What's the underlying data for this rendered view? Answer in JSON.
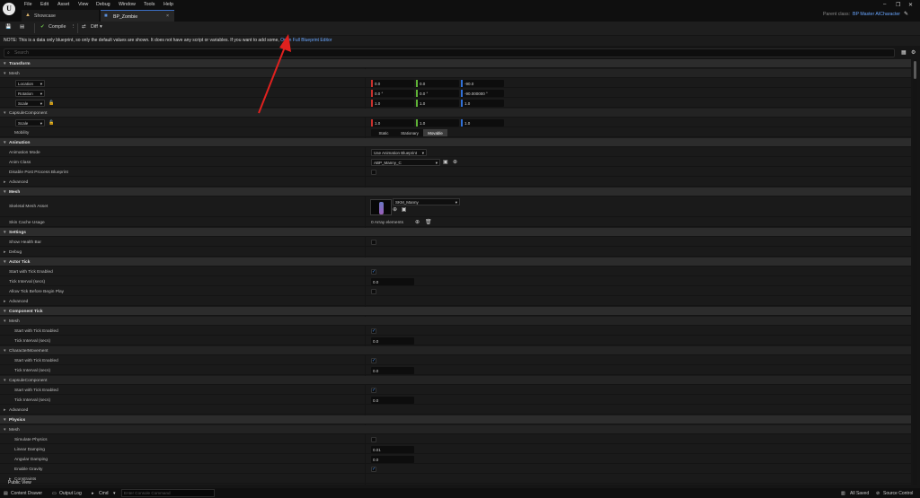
{
  "menu": [
    "File",
    "Edit",
    "Asset",
    "View",
    "Debug",
    "Window",
    "Tools",
    "Help"
  ],
  "tabs": [
    {
      "label": "Showcase"
    },
    {
      "label": "BP_Zombie"
    }
  ],
  "parent_class_label": "Parent class:",
  "parent_class_value": "BP Master AICharacter",
  "toolbar": {
    "compile": "Compile",
    "diff": "Diff"
  },
  "notice": {
    "text": "NOTE: This is a data only blueprint, so only the default values are shown.  It does not have any script or variables.  If you want to add some, ",
    "link": "Open Full Blueprint Editor"
  },
  "search": {
    "placeholder": "Search"
  },
  "transform": {
    "category": "Transform",
    "mesh_header": "Mesh",
    "location_label": "Location",
    "rotation_label": "Rotation",
    "scale_label": "Scale",
    "location": [
      "0.0",
      "0.0",
      "-90.0"
    ],
    "rotation": [
      "0.0 °",
      "0.0 °",
      "-90.000000 °"
    ],
    "scale": [
      "1.0",
      "1.0",
      "1.0"
    ],
    "capsule_header": "CapsuleComponent",
    "capsule_scale": [
      "1.0",
      "1.0",
      "1.0"
    ],
    "mobility_label": "Mobility",
    "mobility_options": [
      "Static",
      "Stationary",
      "Movable"
    ],
    "mobility_selected": "Movable"
  },
  "animation": {
    "category": "Animation",
    "mode_label": "Animation Mode",
    "mode_value": "Use Animation Blueprint",
    "class_label": "Anim Class",
    "class_value": "ABP_Manny_C",
    "dpp_label": "Disable Post Process Blueprint",
    "advanced": "Advanced"
  },
  "mesh": {
    "category": "Mesh",
    "asset_label": "Skeletal Mesh Asset",
    "asset_value": "SKM_Manny",
    "skin_label": "Skin Cache Usage",
    "skin_value": "0 Array elements"
  },
  "settings": {
    "category": "Settings",
    "health_label": "Show Health Bar",
    "debug": "Debug"
  },
  "actor_tick": {
    "category": "Actor Tick",
    "start_label": "Start with Tick Enabled",
    "interval_label": "Tick Interval (secs)",
    "interval_value": "0.0",
    "allow_label": "Allow Tick Before Begin Play",
    "advanced": "Advanced"
  },
  "component_tick": {
    "category": "Component Tick",
    "groups": [
      {
        "name": "Mesh",
        "start": "Start with Tick Enabled",
        "interval": "Tick Interval (secs)",
        "value": "0.0"
      },
      {
        "name": "CharacterMovement",
        "start": "Start with Tick Enabled",
        "interval": "Tick Interval (secs)",
        "value": "0.0"
      },
      {
        "name": "CapsuleComponent",
        "start": "Start with Tick Enabled",
        "interval": "Tick Interval (secs)",
        "value": "0.0"
      }
    ],
    "advanced": "Advanced"
  },
  "physics": {
    "category": "Physics",
    "mesh_header": "Mesh",
    "simulate_label": "Simulate Physics",
    "linear_label": "Linear Damping",
    "linear_value": "0.01",
    "angular_label": "Angular Damping",
    "angular_value": "0.0",
    "gravity_label": "Enable Gravity",
    "constraints": "Constraints"
  },
  "public_view": "Public View",
  "bottom": {
    "content_drawer": "Content Drawer",
    "output_log": "Output Log",
    "cmd": "Cmd",
    "cmd_placeholder": "Enter Console Command",
    "all_saved": "All Saved",
    "source_control": "Source Control"
  },
  "colors": {
    "accent": "#4b9bff",
    "link": "#6aa7ff",
    "annotation_arrow": "#e0211f"
  }
}
